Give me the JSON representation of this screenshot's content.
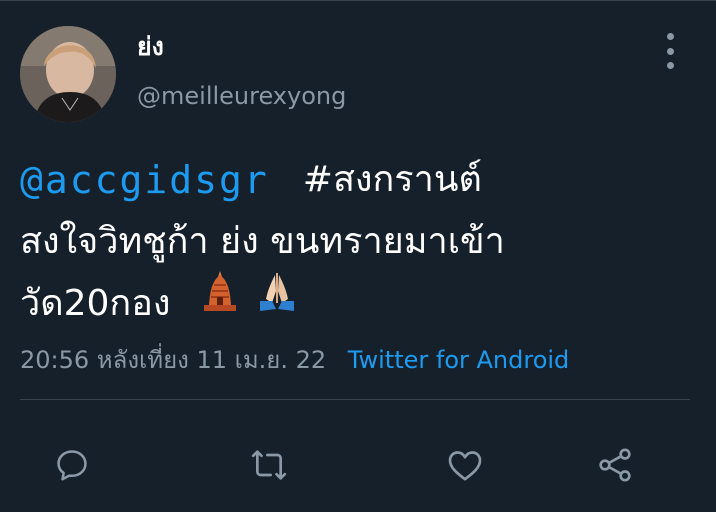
{
  "author": {
    "display_name": "ย่ง",
    "handle": "@meilleurexyong"
  },
  "tweet": {
    "mention": "@accgidsgr",
    "hashtag": "#สงกรานต์",
    "line2": "สงใจวิทชูก้า ย่ง ขนทรายมาเข้า",
    "line3": "วัด20กอง",
    "emojis": [
      "temple-emoji",
      "folded-hands-emoji"
    ]
  },
  "meta": {
    "timestamp": "20:56 หลังเที่ยง  11 เม.ย. 22",
    "source": "Twitter for Android"
  },
  "actions": [
    "reply-icon",
    "retweet-icon",
    "like-icon",
    "share-icon"
  ],
  "colors": {
    "background": "#15202b",
    "text": "#ffffff",
    "muted": "#8b98a5",
    "link": "#1d9bf0",
    "divider": "#38444d"
  }
}
